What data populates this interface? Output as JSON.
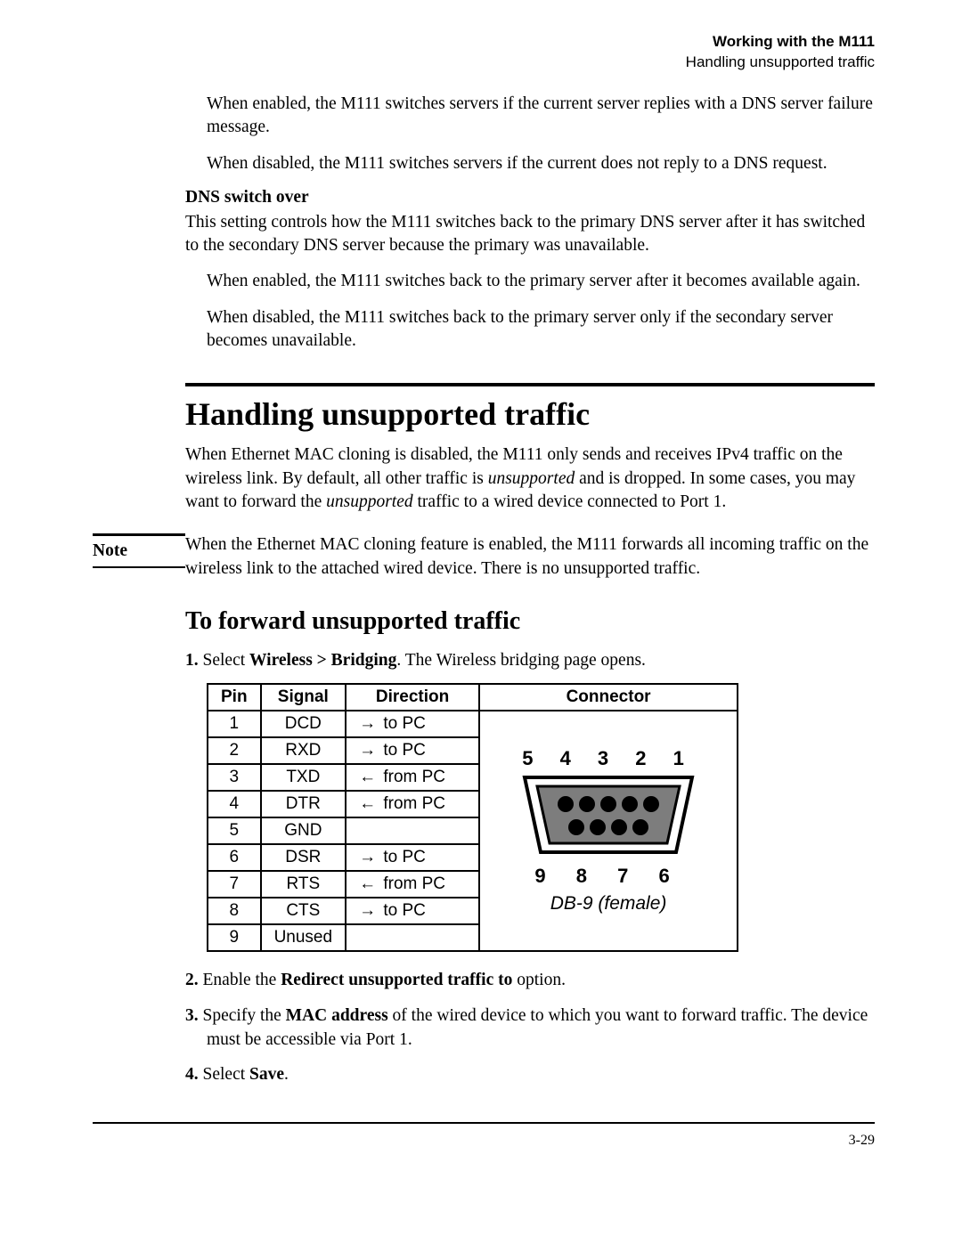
{
  "running_head": {
    "bold": "Working with the M111",
    "plain": "Handling unsupported traffic"
  },
  "intro": {
    "p1": "When enabled, the M111 switches servers if the current server replies with a DNS server failure message.",
    "p2": "When disabled, the M111 switches servers if the current does not reply to a DNS request."
  },
  "dns": {
    "heading": "DNS switch over",
    "p1": "This setting controls how the M111 switches back to the primary DNS server after it has switched to the secondary DNS server because the primary was unavailable.",
    "p2": "When enabled, the M111 switches back to the primary server after it becomes available again.",
    "p3": "When disabled, the M111 switches back to the primary server only if the secondary server becomes unavailable."
  },
  "section": {
    "title": "Handling unsupported traffic",
    "p_pre": "When Ethernet MAC cloning is disabled, the M111 only sends and receives IPv4 traffic on the wireless link. By default, all other traffic is ",
    "p_ital": "unsupported",
    "p_post": " and is dropped. In some cases, you may want to forward the ",
    "p_ital2": "unsupported",
    "p_post2": " traffic to a wired device connected to Port 1."
  },
  "note": {
    "label": "Note",
    "body": "When the Ethernet MAC cloning feature is enabled, the M111 forwards all incoming traffic on the wireless link to the attached wired device. There is no unsupported traffic."
  },
  "subsection": {
    "title": "To forward unsupported traffic"
  },
  "steps": {
    "s1_pre": "Select ",
    "s1_bold": "Wireless > Bridging",
    "s1_post": ". The Wireless bridging page opens.",
    "s2_pre": "Enable the ",
    "s2_bold": "Redirect unsupported traffic to",
    "s2_post": " option.",
    "s3_pre": "Specify the ",
    "s3_bold": "MAC address",
    "s3_post": " of the wired device to which you want to forward traffic. The device must be accessible via Port 1.",
    "s4_pre": "Select ",
    "s4_bold": "Save",
    "s4_post": "."
  },
  "table": {
    "headers": {
      "pin": "Pin",
      "signal": "Signal",
      "direction": "Direction",
      "connector": "Connector"
    },
    "rows": [
      {
        "pin": "1",
        "signal": "DCD",
        "arrow": "→",
        "dir": "to PC"
      },
      {
        "pin": "2",
        "signal": "RXD",
        "arrow": "→",
        "dir": "to PC"
      },
      {
        "pin": "3",
        "signal": "TXD",
        "arrow": "←",
        "dir": "from PC"
      },
      {
        "pin": "4",
        "signal": "DTR",
        "arrow": "←",
        "dir": "from PC"
      },
      {
        "pin": "5",
        "signal": "GND",
        "arrow": "",
        "dir": ""
      },
      {
        "pin": "6",
        "signal": "DSR",
        "arrow": "→",
        "dir": "to PC"
      },
      {
        "pin": "7",
        "signal": "RTS",
        "arrow": "←",
        "dir": "from PC"
      },
      {
        "pin": "8",
        "signal": "CTS",
        "arrow": "→",
        "dir": "to PC"
      },
      {
        "pin": "9",
        "signal": "Unused",
        "arrow": "",
        "dir": ""
      }
    ],
    "connector": {
      "top_labels": "5  4  3  2  1",
      "bottom_labels": "9  8  7  6",
      "caption": "DB-9 (female)"
    }
  },
  "footer": {
    "page": "3-29"
  }
}
